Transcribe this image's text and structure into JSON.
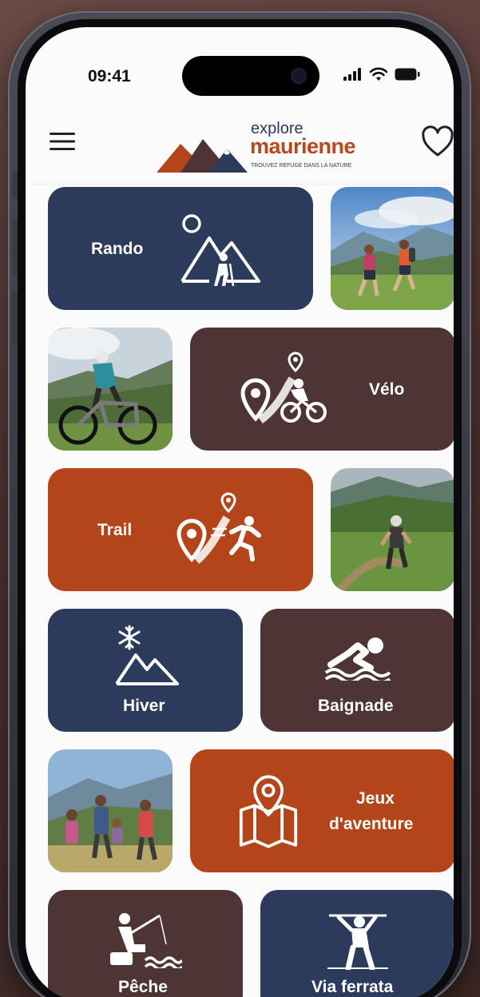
{
  "status_bar": {
    "time": "09:41"
  },
  "header": {
    "logo_line1": "explore",
    "logo_line2": "maurienne",
    "logo_tagline": "TROUVEZ REFUGE DANS LA NATURE"
  },
  "activities": {
    "rando": "Rando",
    "velo": "Vélo",
    "trail": "Trail",
    "hiver": "Hiver",
    "baignade": "Baignade",
    "jeux_line1": "Jeux",
    "jeux_line2": "d'aventure",
    "peche": "Pêche",
    "via_ferrata": "Via ferrata"
  },
  "colors": {
    "navy": "#2c3a5c",
    "brown": "#4e3434",
    "rust": "#b4451b"
  },
  "icons": {
    "menu": "hamburger-menu-icon",
    "favorite": "heart-icon",
    "rando": "mountain-hiker-icon",
    "velo": "map-pin-cyclist-icon",
    "trail": "map-pin-runner-icon",
    "hiver": "snowflake-mountain-icon",
    "baignade": "swimmer-icon",
    "jeux": "map-pin-map-icon",
    "peche": "fisherman-icon",
    "via_ferrata": "climber-icon"
  }
}
